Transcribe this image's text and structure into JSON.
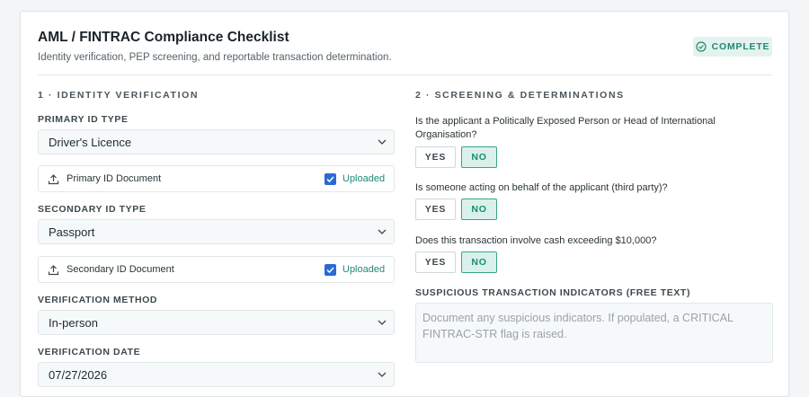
{
  "header": {
    "title": "AML / FINTRAC Compliance Checklist",
    "subtitle": "Identity verification, PEP screening, and reportable transaction determination.",
    "status_badge": "COMPLETE",
    "status_color": "#1e8a70"
  },
  "left": {
    "section_title": "1 · IDENTITY VERIFICATION",
    "primary_id_label": "PRIMARY ID TYPE",
    "primary_id_value": "Driver's Licence",
    "primary_doc_label": "Primary ID Document",
    "primary_doc_status": "Uploaded",
    "secondary_id_label": "SECONDARY ID TYPE",
    "secondary_id_value": "Passport",
    "secondary_doc_label": "Secondary ID Document",
    "secondary_doc_status": "Uploaded",
    "method_label": "VERIFICATION METHOD",
    "method_value": "In-person",
    "date_label": "VERIFICATION DATE",
    "date_value": "07/27/2026"
  },
  "right": {
    "section_title": "2 · SCREENING & DETERMINATIONS",
    "questions": [
      {
        "text": "Is the applicant a Politically Exposed Person or Head of International Organisation?",
        "yes": "YES",
        "no": "NO",
        "selected": "NO"
      },
      {
        "text": "Is someone acting on behalf of the applicant (third party)?",
        "yes": "YES",
        "no": "NO",
        "selected": "NO"
      },
      {
        "text": "Does this transaction involve cash exceeding $10,000?",
        "yes": "YES",
        "no": "NO",
        "selected": "NO"
      }
    ],
    "indicators_label": "SUSPICIOUS TRANSACTION INDICATORS (FREE TEXT)",
    "indicators_placeholder": "Document any suspicious indicators. If populated, a CRITICAL FINTRAC-STR flag is raised.",
    "indicators_value": ""
  },
  "icons": {
    "badge": "check-circle-icon",
    "upload": "upload-icon",
    "checkbox": "checkbox-checked-icon",
    "select": "chevron-down-icon"
  }
}
